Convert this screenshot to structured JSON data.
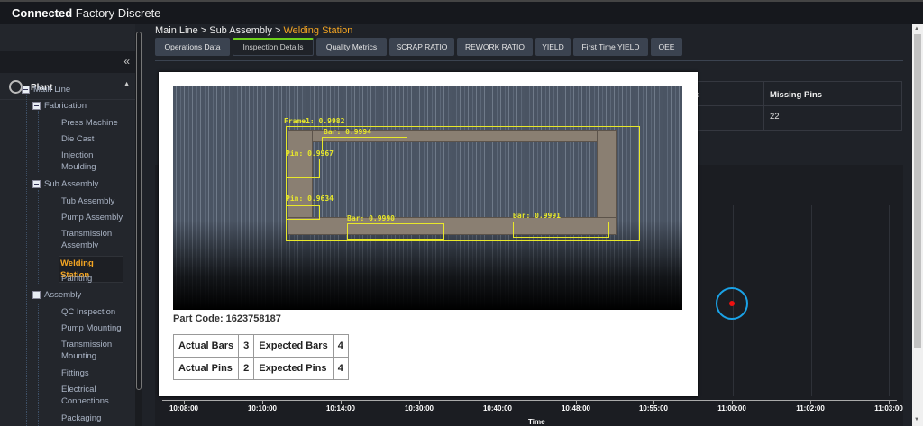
{
  "app": {
    "title_bold": "Connected",
    "title_rest": " Factory Discrete"
  },
  "sidebar": {
    "collapse_icon": "double-chevron-left",
    "root": "Plant",
    "tree": {
      "main_line": "Main Line",
      "fabrication": {
        "label": "Fabrication",
        "items": [
          "Press Machine",
          "Die Cast",
          "Injection Moulding"
        ]
      },
      "sub_assembly": {
        "label": "Sub Assembly",
        "items": [
          "Tub Assembly",
          "Pump Assembly",
          "Transmission Assembly",
          "Welding Station",
          "Painting"
        ]
      },
      "assembly": {
        "label": "Assembly",
        "items": [
          "QC Inspection",
          "Pump Mounting",
          "Transmission Mounting",
          "Fittings",
          "Electrical Connections",
          "Packaging"
        ]
      }
    },
    "selected": "Welding Station"
  },
  "breadcrumb": {
    "path": "Main Line > Sub Assembly > ",
    "current": "Welding Station"
  },
  "tabs": [
    "Operations Data",
    "Inspection Details",
    "Quality Metrics",
    "SCRAP RATIO",
    "REWORK RATIO",
    "YIELD",
    "First Time YIELD",
    "OEE"
  ],
  "active_tab": "Inspection Details",
  "table": {
    "header": "Missing Pins",
    "partial_header": "s",
    "value": "22"
  },
  "modal": {
    "detections": [
      "Frame1: 0.9982",
      "Bar: 0.9994",
      "Pin: 0.9967",
      "Pin: 0.9634",
      "Bar: 0.9990",
      "Bar: 0.9991"
    ],
    "part_code": "Part Code: 1623758187",
    "counts": [
      [
        "Actual Bars",
        "3",
        "Expected Bars",
        "4"
      ],
      [
        "Actual Pins",
        "2",
        "Expected Pins",
        "4"
      ]
    ]
  },
  "chart_data": {
    "type": "scatter",
    "xlabel": "Time",
    "x_ticks": [
      "10:08:00",
      "10:10:00",
      "10:14:00",
      "10:30:00",
      "10:40:00",
      "10:48:00",
      "10:55:00",
      "11:00:00",
      "11:02:00",
      "11:03:00"
    ],
    "points": [
      {
        "x": "11:00:00",
        "highlighted": true
      }
    ],
    "colors": {
      "point": "#ee1111",
      "ring": "#1aa3e8"
    }
  }
}
